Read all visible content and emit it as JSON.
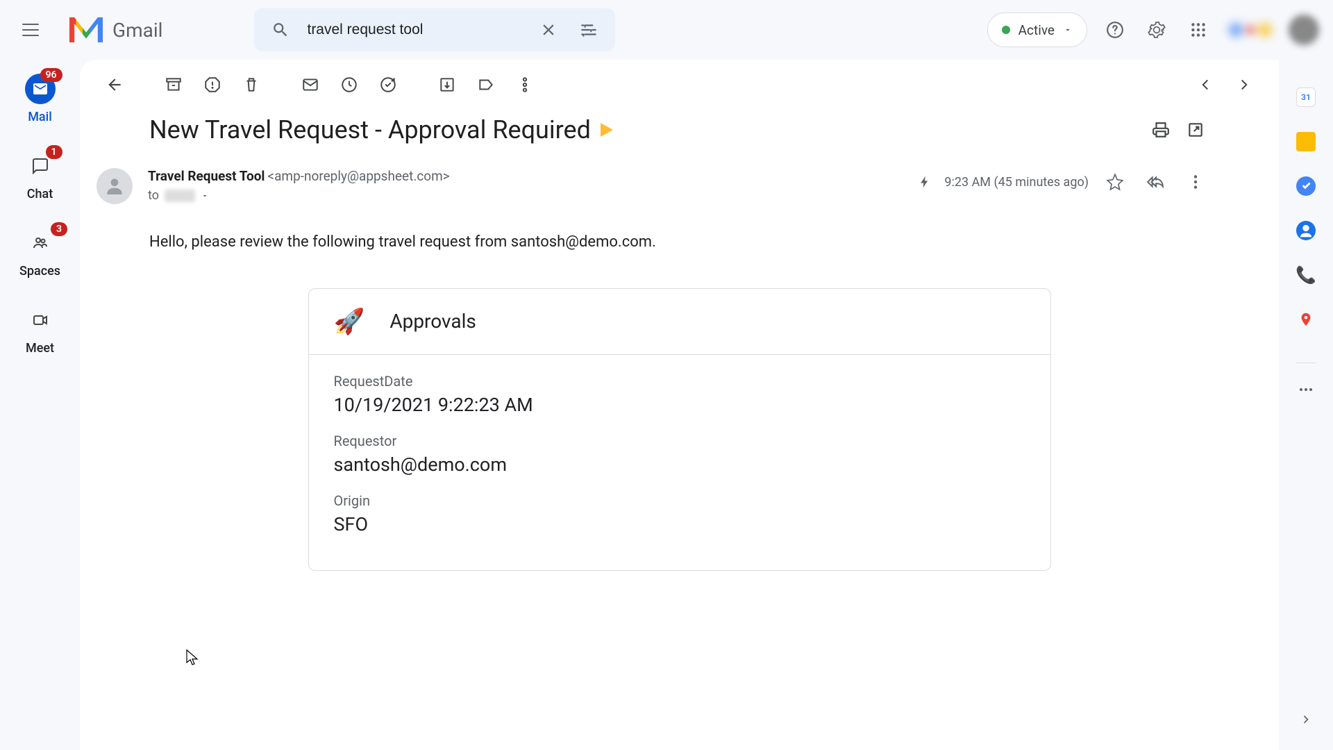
{
  "app": {
    "name": "Gmail"
  },
  "search": {
    "query": "travel request tool"
  },
  "status": {
    "label": "Active"
  },
  "nav": {
    "mail": {
      "label": "Mail",
      "badge": "96"
    },
    "chat": {
      "label": "Chat",
      "badge": "1"
    },
    "spaces": {
      "label": "Spaces",
      "badge": "3"
    },
    "meet": {
      "label": "Meet"
    }
  },
  "email": {
    "subject": "New Travel Request - Approval Required",
    "sender_name": "Travel Request Tool",
    "sender_email": "<amp-noreply@appsheet.com>",
    "to_label": "to",
    "timestamp": "9:23 AM (45 minutes ago)",
    "body_intro": "Hello, please review the following travel request from santosh@demo.com."
  },
  "card": {
    "title": "Approvals",
    "fields": [
      {
        "label": "RequestDate",
        "value": "10/19/2021 9:22:23 AM"
      },
      {
        "label": "Requestor",
        "value": "santosh@demo.com"
      },
      {
        "label": "Origin",
        "value": "SFO"
      }
    ]
  },
  "side_cal": "31"
}
